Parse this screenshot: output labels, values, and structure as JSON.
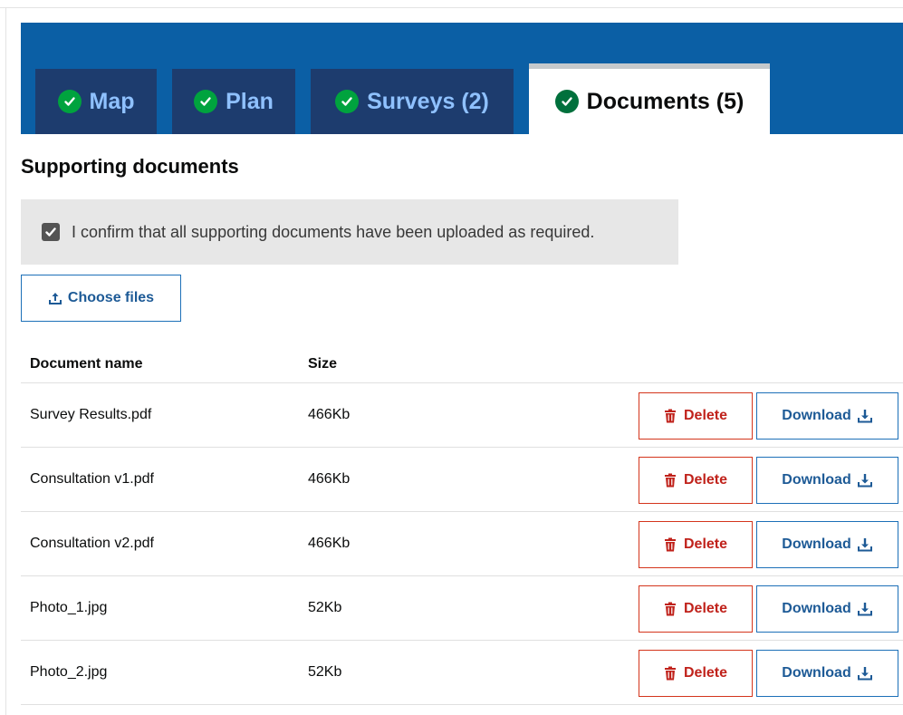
{
  "tabs": [
    {
      "label": "Map",
      "state": "inactive"
    },
    {
      "label": "Plan",
      "state": "inactive"
    },
    {
      "label": "Surveys (2)",
      "state": "inactive"
    },
    {
      "label": "Documents (5)",
      "state": "active"
    }
  ],
  "section": {
    "title": "Supporting documents",
    "confirm_text": "I confirm that all supporting documents have been uploaded as required.",
    "confirm_checked": true,
    "choose_files_label": "Choose files"
  },
  "table": {
    "headers": [
      "Document name",
      "Size"
    ],
    "rows": [
      {
        "name": "Survey Results.pdf",
        "size": "466Kb"
      },
      {
        "name": "Consultation v1.pdf",
        "size": "466Kb"
      },
      {
        "name": "Consultation v2.pdf",
        "size": "466Kb"
      },
      {
        "name": "Photo_1.jpg",
        "size": "52Kb"
      },
      {
        "name": "Photo_2.jpg",
        "size": "52Kb"
      }
    ],
    "delete_label": "Delete",
    "download_label": "Download"
  },
  "colors": {
    "tab_bar": "#0b5fa5",
    "tab_inactive": "#1d3c6e",
    "check_green": "#00a33e",
    "delete_red": "#c0221b",
    "link_blue": "#1d5a96"
  },
  "icons": {
    "tab_status": "check-circle-icon",
    "choose_files": "upload-icon",
    "delete": "trash-icon",
    "download": "download-icon",
    "confirm": "checkbox-checked-icon"
  }
}
